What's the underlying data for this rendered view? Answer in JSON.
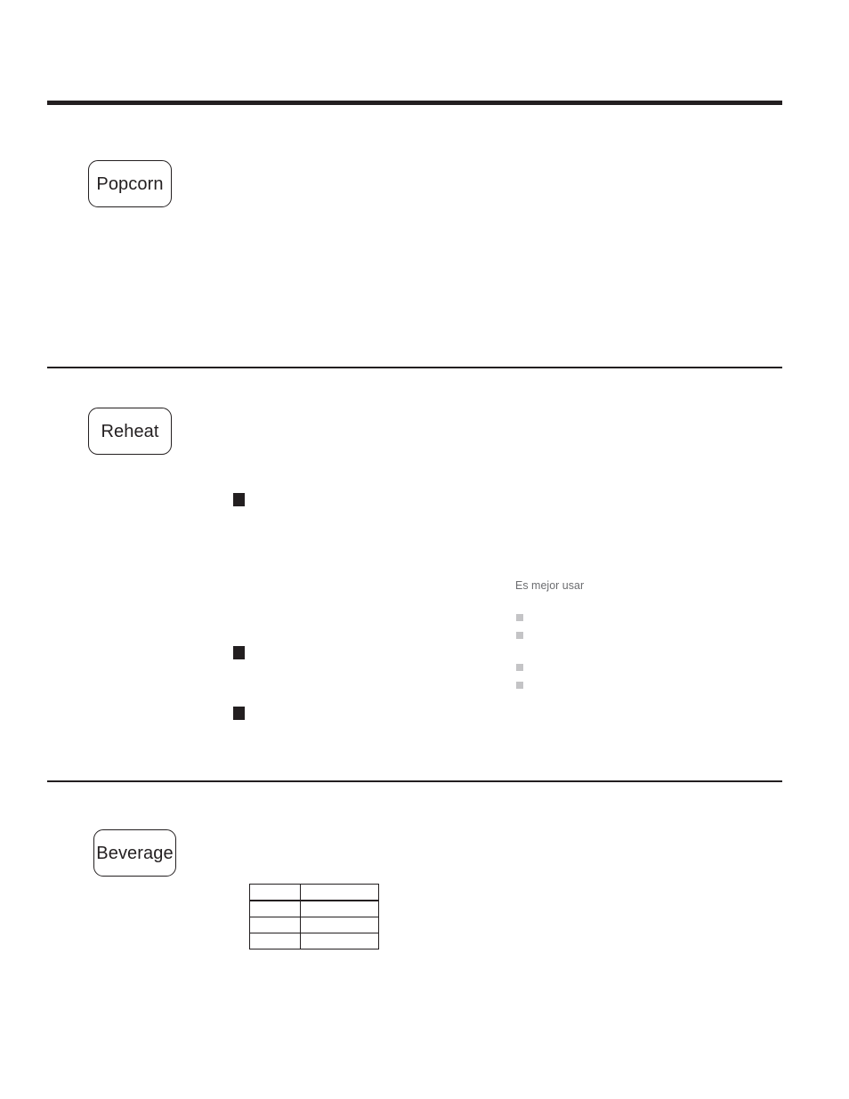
{
  "page": {
    "background_color": "#ffffff",
    "rule_color": "#231f20",
    "text_color": "#231f20",
    "muted_text_color": "#6d6e71",
    "muted_bullet_color": "#c4c4c6"
  },
  "sections": [
    {
      "id": "popcorn",
      "rule": {
        "name": "rule-top",
        "style": "thick"
      },
      "button": {
        "label": "Popcorn"
      },
      "bullets": []
    },
    {
      "id": "reheat",
      "rule": {
        "name": "rule-middle",
        "style": "thin"
      },
      "button": {
        "label": "Reheat"
      },
      "bullets": [
        {
          "label": "",
          "marker": "black-square"
        },
        {
          "label": "",
          "marker": "black-square"
        },
        {
          "label": "",
          "marker": "black-square"
        }
      ],
      "spanish_column": {
        "heading": "Es mejor usar",
        "bullets": [
          {
            "label": "",
            "marker": "gray-square"
          },
          {
            "label": "",
            "marker": "gray-square"
          },
          {
            "label": "",
            "marker": "gray-square"
          },
          {
            "label": "",
            "marker": "gray-square"
          }
        ]
      }
    },
    {
      "id": "beverage",
      "rule": {
        "name": "rule-bottom",
        "style": "thin"
      },
      "button": {
        "label": "Beverage"
      },
      "table": {
        "headers": [
          "",
          ""
        ],
        "rows": [
          [
            "",
            ""
          ],
          [
            "",
            ""
          ],
          [
            "",
            ""
          ]
        ]
      }
    }
  ]
}
